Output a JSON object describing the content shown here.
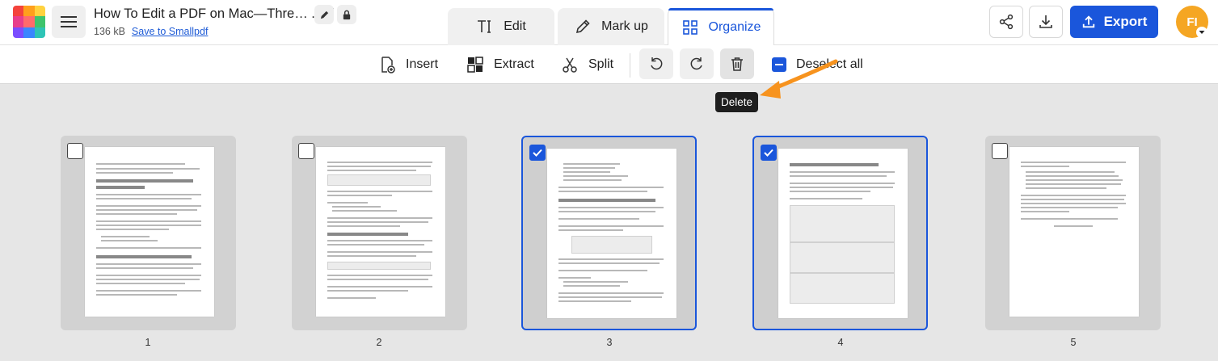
{
  "header": {
    "filename": "How To Edit a PDF on Mac—Thre… .pdf",
    "file_size": "136 kB",
    "save_link": "Save to Smallpdf",
    "tabs": [
      {
        "label": "Edit",
        "icon": "text-cursor-icon",
        "active": false
      },
      {
        "label": "Mark up",
        "icon": "pencil-icon",
        "active": false
      },
      {
        "label": "Organize",
        "icon": "grid-icon",
        "active": true
      }
    ],
    "export_label": "Export",
    "avatar_initials": "FI",
    "accent": "#1a56db"
  },
  "toolbar": {
    "insert": "Insert",
    "extract": "Extract",
    "split": "Split",
    "deselect_all": "Deselect all",
    "tooltip": "Delete"
  },
  "pages": [
    {
      "number": "1",
      "selected": false
    },
    {
      "number": "2",
      "selected": false
    },
    {
      "number": "3",
      "selected": true
    },
    {
      "number": "4",
      "selected": true
    },
    {
      "number": "5",
      "selected": false
    }
  ]
}
